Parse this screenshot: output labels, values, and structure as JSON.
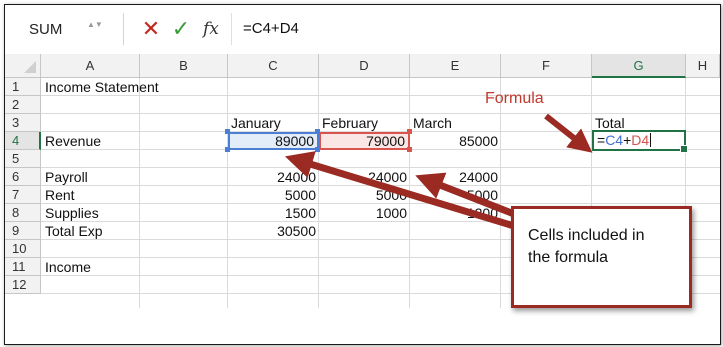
{
  "formula_bar": {
    "name_box": "SUM",
    "stepper": "▲▼",
    "cancel_glyph": "✕",
    "enter_glyph": "✓",
    "fx_label": "fx",
    "formula": "=C4+D4"
  },
  "columns": [
    "A",
    "B",
    "C",
    "D",
    "E",
    "F",
    "G",
    "H"
  ],
  "rows": [
    "1",
    "2",
    "3",
    "4",
    "5",
    "6",
    "7",
    "8",
    "9",
    "10",
    "11",
    "12"
  ],
  "cells": {
    "A1": "Income Statement",
    "C3": "January",
    "D3": "February",
    "E3": "March",
    "G3": "Total",
    "A4": "Revenue",
    "C4": "89000",
    "D4": "79000",
    "E4": "85000",
    "A6": "Payroll",
    "C6": "24000",
    "D6": "24000",
    "E6": "24000",
    "A7": "Rent",
    "C7": "5000",
    "D7": "5000",
    "E7": "5000",
    "A8": "Supplies",
    "C8": "1500",
    "D8": "1000",
    "E8": "1200",
    "A9": "Total Exp",
    "C9": "30500",
    "A11": "Income"
  },
  "active_cell": {
    "ref": "G4",
    "parts": {
      "eq": "=",
      "ref1": "C4",
      "plus": "+",
      "ref2": "D4"
    }
  },
  "annotations": {
    "formula_label": "Formula",
    "cells_box_line1": "Cells included in",
    "cells_box_line2": "the formula"
  },
  "colors": {
    "accent_green": "#217346",
    "ref_blue": "#4a7fd4",
    "ref_red": "#d9534f",
    "arrow": "#9b2a22",
    "cancel_red": "#c2271d",
    "enter_green": "#3a9a36"
  }
}
